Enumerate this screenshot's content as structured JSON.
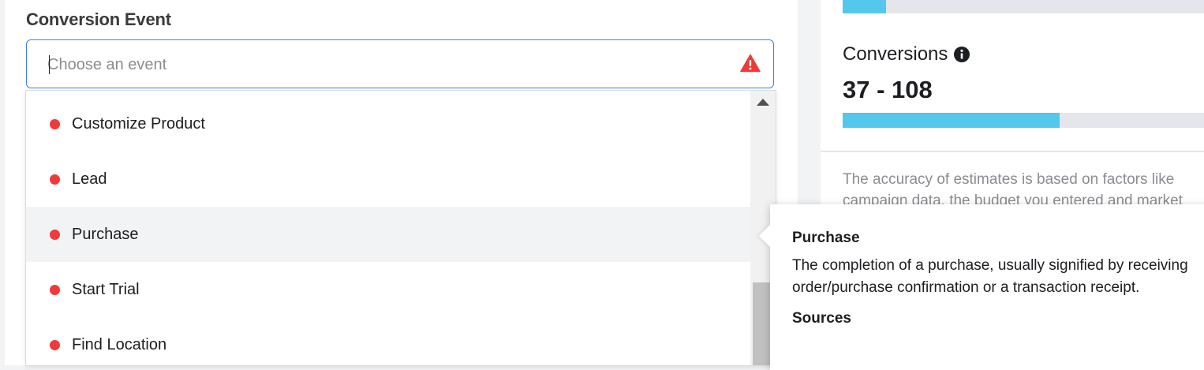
{
  "conversion_event": {
    "title": "Conversion Event",
    "input_placeholder": "Choose an event",
    "input_value": ""
  },
  "dropdown": {
    "items": [
      {
        "label": "Customize Product",
        "status_color": "#ee3a3a"
      },
      {
        "label": "Lead",
        "status_color": "#ee3a3a"
      },
      {
        "label": "Purchase",
        "status_color": "#ee3a3a",
        "hovered": true
      },
      {
        "label": "Start Trial",
        "status_color": "#ee3a3a"
      },
      {
        "label": "Find Location",
        "status_color": "#ee3a3a"
      }
    ]
  },
  "estimates": {
    "top_bar_fill_fraction": 0.12,
    "conversions_label": "Conversions",
    "conversions_value": "37 - 108",
    "conversions_bar_fill_fraction": 0.6,
    "accuracy_text_line1": "The accuracy of estimates is based on factors like",
    "accuracy_text_line2": "campaign data, the budget you entered and market"
  },
  "tooltip": {
    "title": "Purchase",
    "description": "The completion of a purchase, usually signified by receiving order/purchase confirmation or a transaction receipt.",
    "sources_label": "Sources"
  },
  "colors": {
    "accent_blue": "#3b82e6",
    "warning_red": "#ee3a3a",
    "bar_fill": "#54c7ec"
  },
  "icons": {
    "warning": "warning-triangle-icon",
    "info": "info-icon"
  }
}
